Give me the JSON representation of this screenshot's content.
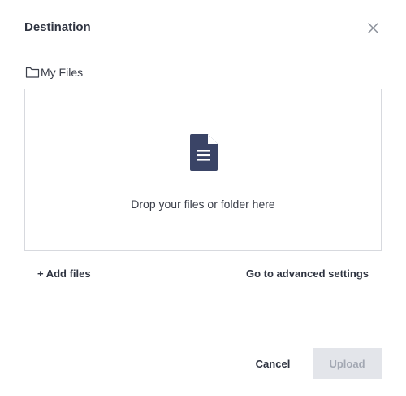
{
  "dialog": {
    "title": "Destination",
    "close_icon": "close-icon"
  },
  "breadcrumb": {
    "icon": "folder-icon",
    "label": "My Files"
  },
  "dropzone": {
    "icon": "document-icon",
    "text": "Drop your files or folder here"
  },
  "actions": {
    "add_files_label": "+ Add files",
    "advanced_settings_label": "Go to advanced settings"
  },
  "footer": {
    "cancel_label": "Cancel",
    "upload_label": "Upload",
    "upload_enabled": false
  },
  "colors": {
    "text": "#2f3441",
    "icon_dark": "#3a4466",
    "border": "#d7d9de",
    "disabled_bg": "#e3e5ea",
    "disabled_text": "#a3a8b3"
  }
}
